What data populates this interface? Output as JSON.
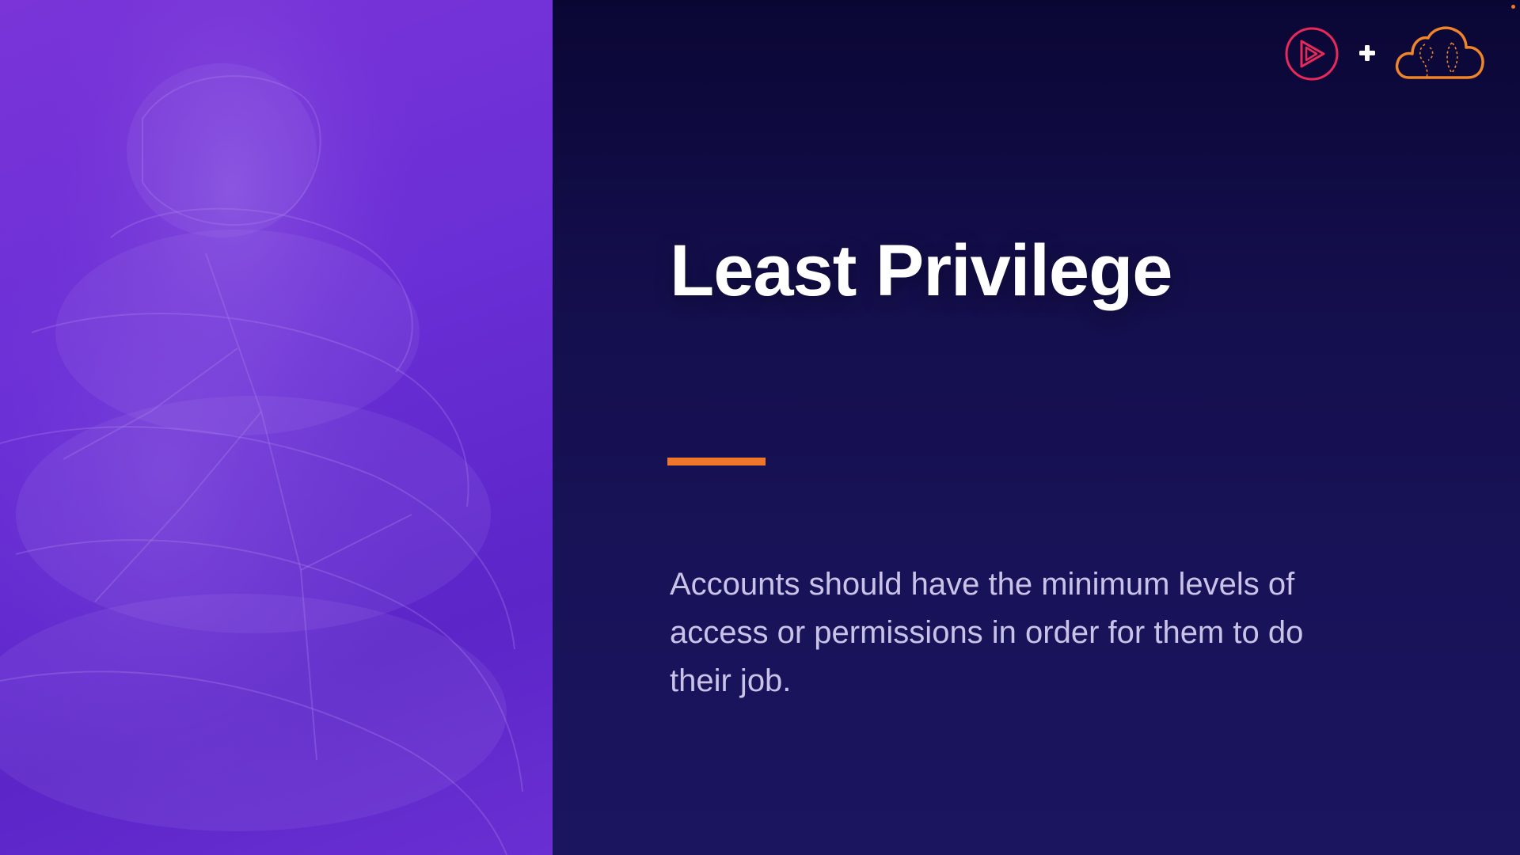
{
  "slide": {
    "title": "Least Privilege",
    "body": "Accounts should have the minimum levels of access or permissions in order for them to do their job."
  },
  "logos": {
    "play": "play-logo-icon",
    "plus": "plus-icon",
    "cloud": "cloud-logo-icon"
  },
  "colors": {
    "left_panel": "#6a2fd6",
    "right_panel": "#130e4a",
    "accent": "#f0762a",
    "play_logo": "#e8295a",
    "title": "#ffffff",
    "body_text": "#c9c3e8"
  }
}
